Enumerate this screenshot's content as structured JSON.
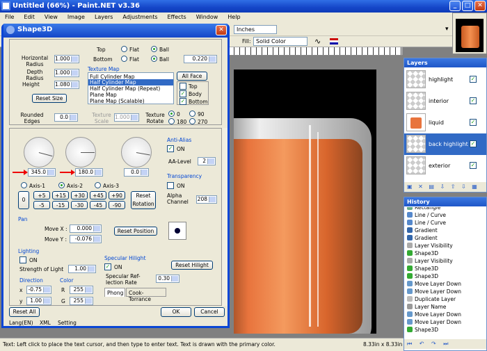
{
  "app": {
    "title": "Untitled (66%) - Paint.NET v3.36"
  },
  "menu": [
    "File",
    "Edit",
    "View",
    "Image",
    "Layers",
    "Adjustments",
    "Effects",
    "Window",
    "Help"
  ],
  "toolbar": {
    "units": "Inches",
    "fill_label": "Fill:",
    "fill_value": "Solid Color"
  },
  "layers": {
    "title": "Layers",
    "items": [
      {
        "name": "highlight"
      },
      {
        "name": "interior"
      },
      {
        "name": "liquid"
      },
      {
        "name": "back highlight"
      },
      {
        "name": "exterior"
      }
    ]
  },
  "history": {
    "title": "History",
    "items": [
      "Rectangle",
      "Line / Curve",
      "Line / Curve",
      "Gradient",
      "Gradient",
      "Layer Visibility",
      "Shape3D",
      "Layer Visibility",
      "Shape3D",
      "Shape3D",
      "Move Layer Down",
      "Move Layer Down",
      "Duplicate Layer",
      "Layer Name",
      "Move Layer Down",
      "Move Layer Down",
      "Shape3D"
    ]
  },
  "status": {
    "text": "Text: Left click to place the text cursor, and then type to enter text. Text is drawn with the primary color.",
    "size": "8.33in x 8.33in"
  },
  "dialog": {
    "title": "Shape3D",
    "top": {
      "radio_row1": "Top",
      "flat": "Flat",
      "ball": "Ball",
      "radio_row2": "Bottom",
      "bottom_val": "0.220",
      "h_radius_label": "Horizontal Radius",
      "h_radius": "1.000",
      "depth_label": "Depth Radius",
      "depth": "1.000",
      "height_label": "Height",
      "height": "1.080",
      "reset_size": "Reset Size",
      "rounded_label": "Rounded Edges",
      "rounded": "0.0"
    },
    "texture": {
      "title": "Texture Map",
      "options": [
        "Full Cylinder Map",
        "Half Cylinder Map",
        "Half Cylinder Map (Repeat)",
        "Plane Map",
        "Plane Map (Scalable)"
      ],
      "selected": "Half Cylinder Map",
      "all_face": "All Face",
      "faces": [
        "Top",
        "Body",
        "Bottom"
      ],
      "scale_label": "Texture Scale",
      "scale": "1.000",
      "rotate_label": "Texture Rotate",
      "rot_opts": [
        "0",
        "90",
        "180",
        "270"
      ]
    },
    "rotation": {
      "dials": [
        {
          "value": "345.0",
          "angle": 15
        },
        {
          "value": "180.0",
          "angle": 0
        },
        {
          "value": "0.0",
          "angle": 10
        }
      ],
      "axes": [
        "Axis-1",
        "Axis-2",
        "Axis-3"
      ],
      "plus": [
        "+5",
        "+15",
        "+30",
        "+45",
        "+90"
      ],
      "minus": [
        "-5",
        "-15",
        "-30",
        "-45",
        "-90"
      ],
      "zero": "0",
      "reset": "Reset Rotation"
    },
    "antialias": {
      "title": "Anti-Alias",
      "on": "ON",
      "level_label": "AA-Level",
      "level": "2"
    },
    "transparency": {
      "title": "Transparency",
      "on": "ON",
      "alpha_label": "Alpha Channel",
      "alpha": "208"
    },
    "pan": {
      "title": "Pan",
      "movex_label": "Move X :",
      "movex": "0.000",
      "movey_label": "Move Y :",
      "movey": "-0.076",
      "reset": "Reset Position"
    },
    "lighting": {
      "title": "Lighting",
      "on": "ON",
      "strength_label": "Strength of Light",
      "strength": "1.00",
      "direction": "Direction",
      "x_label": "x",
      "x": "-0.75",
      "y_label": "y",
      "y": "1.00",
      "color": "Color",
      "r_label": "R",
      "r": "255",
      "g_label": "G",
      "g": "255"
    },
    "specular": {
      "title": "Specular Hilight",
      "on": "ON",
      "reset": "Reset Hilight",
      "refl_label": "Specular Ref- lection Rate",
      "refl": "0.30",
      "tabs": [
        "Phong",
        "Cook-Torrance"
      ]
    },
    "reset_all": "Reset All",
    "ok": "OK",
    "cancel": "Cancel",
    "footer": [
      "Lang(EN)",
      "XML",
      "Setting"
    ]
  }
}
